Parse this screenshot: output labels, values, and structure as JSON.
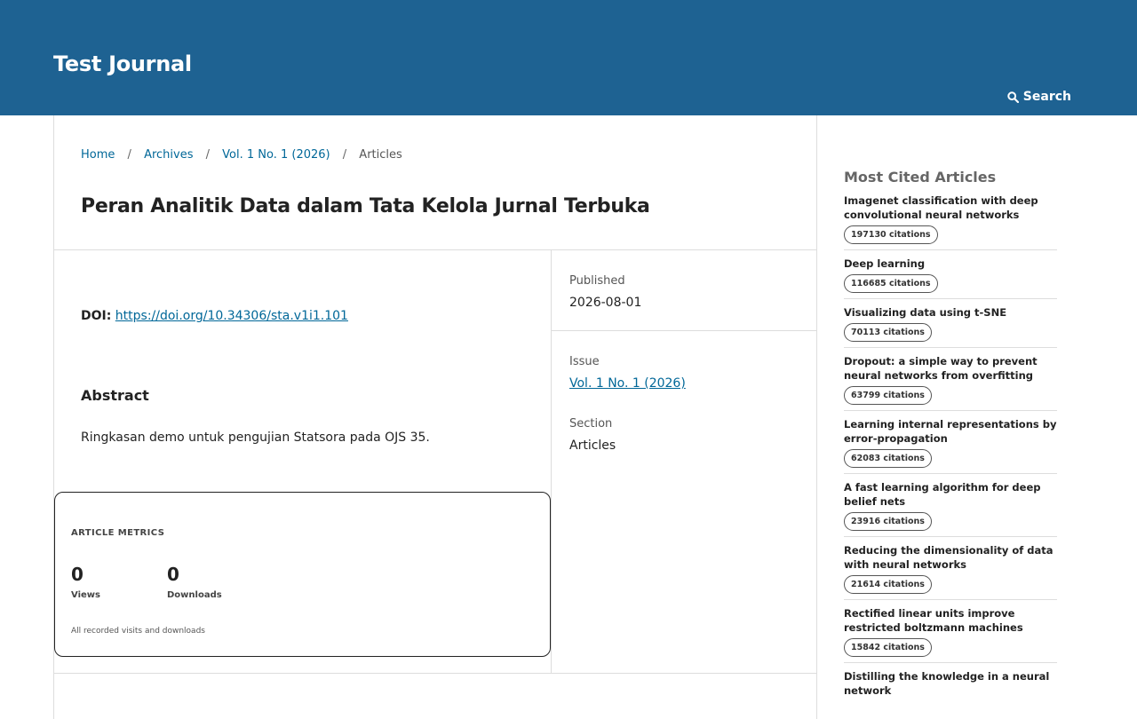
{
  "header": {
    "site_title": "Test Journal",
    "search_label": "Search"
  },
  "breadcrumb": {
    "home": "Home",
    "archives": "Archives",
    "issue": "Vol. 1 No. 1 (2026)",
    "current": "Articles",
    "separator": "/"
  },
  "article": {
    "title": "Peran Analitik Data dalam Tata Kelola Jurnal Terbuka",
    "doi_label": "DOI:",
    "doi_url": "https://doi.org/10.34306/sta.v1i1.101",
    "abstract_heading": "Abstract",
    "abstract_text": "Ringkasan demo untuk pengujian Statsora pada OJS 35."
  },
  "metrics": {
    "title": "ARTICLE METRICS",
    "views_value": "0",
    "views_label": "Views",
    "downloads_value": "0",
    "downloads_label": "Downloads",
    "note": "All recorded visits and downloads"
  },
  "details": {
    "published_label": "Published",
    "published_value": "2026-08-01",
    "issue_label": "Issue",
    "issue_value": "Vol. 1 No. 1 (2026)",
    "section_label": "Section",
    "section_value": "Articles"
  },
  "sidebar": {
    "title": "Most Cited Articles",
    "items": [
      {
        "title": "Imagenet classification with deep convolutional neural networks",
        "citations": "197130 citations"
      },
      {
        "title": "Deep learning",
        "citations": "116685 citations"
      },
      {
        "title": "Visualizing data using t-SNE",
        "citations": "70113 citations"
      },
      {
        "title": "Dropout: a simple way to prevent neural networks from overfitting",
        "citations": "63799 citations"
      },
      {
        "title": "Learning internal representations by error-propagation",
        "citations": "62083 citations"
      },
      {
        "title": "A fast learning algorithm for deep belief nets",
        "citations": "23916 citations"
      },
      {
        "title": "Reducing the dimensionality of data with neural networks",
        "citations": "21614 citations"
      },
      {
        "title": "Rectified linear units improve restricted boltzmann machines",
        "citations": "15842 citations"
      },
      {
        "title": "Distilling the knowledge in a neural network",
        "citations": ""
      }
    ]
  },
  "colors": {
    "header_bg": "#1e6292",
    "link": "#006798"
  },
  "icons": {
    "search": "search-icon"
  }
}
